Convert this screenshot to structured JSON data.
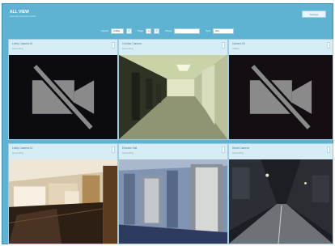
{
  "app": {
    "title": "ALL VIEW",
    "subtitle": "Security camera monitor",
    "top_button": "Settings"
  },
  "filters": [
    {
      "label": "Layout",
      "value": "3 Max",
      "button": "▾"
    },
    {
      "label": "Page",
      "value": "1",
      "button": "▾"
    },
    {
      "label": "Group",
      "value": "",
      "button": ""
    },
    {
      "label": "Sort",
      "value": "ALL",
      "button": ""
    }
  ],
  "cameras": [
    {
      "name": "Lobby Camera 01",
      "detail": "Recording",
      "feed": "offline"
    },
    {
      "name": "Corridor Camera",
      "detail": "Recording",
      "feed": "corridor"
    },
    {
      "name": "Camera 03",
      "detail": "Offline",
      "feed": "offline"
    },
    {
      "name": "Lobby Camera 02",
      "detail": "Recording",
      "feed": "lobby"
    },
    {
      "name": "Elevator Hall",
      "detail": "Recording",
      "feed": "elevator"
    },
    {
      "name": "Street Camera",
      "detail": "Recording",
      "feed": "street"
    }
  ],
  "icons": {
    "offline_feed": "no-video-icon",
    "camera_menu": "kebab-menu-icon"
  },
  "colors": {
    "frame": "#5fb3d2",
    "tile": "#d7edf6",
    "offline_bg": "#0c0c10"
  }
}
